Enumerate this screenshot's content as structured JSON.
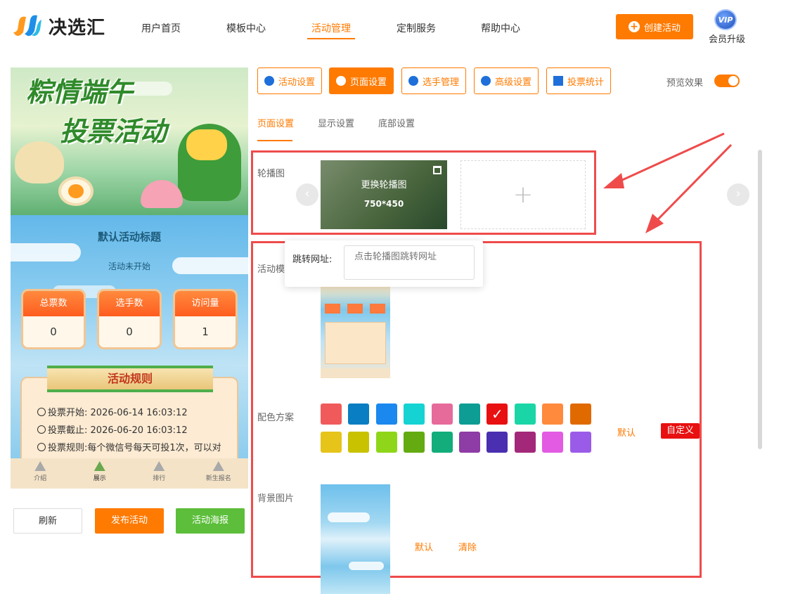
{
  "brand": {
    "name": "决选汇"
  },
  "nav": {
    "items": [
      "用户首页",
      "模板中心",
      "活动管理",
      "定制服务",
      "帮助中心"
    ],
    "active_index": 2
  },
  "header": {
    "create_label": "创建活动",
    "vip_badge": "VIP",
    "vip_label": "会员升级"
  },
  "preview": {
    "banner_line1": "粽情端午",
    "banner_line2": "投票活动",
    "title": "默认活动标题",
    "status": "活动未开始",
    "stats": [
      {
        "label": "总票数",
        "value": "0"
      },
      {
        "label": "选手数",
        "value": "0"
      },
      {
        "label": "访问量",
        "value": "1"
      }
    ],
    "rules_title": "活动规则",
    "rules": [
      {
        "label": "投票开始:",
        "value": "2026-06-14 16:03:12"
      },
      {
        "label": "投票截止:",
        "value": "2026-06-20 16:03:12"
      },
      {
        "label": "投票规则:",
        "value": "每个微信号每天可投1次，可以对"
      }
    ],
    "tabbar": [
      "介绍",
      "展示",
      "排行",
      "新生报名"
    ],
    "tabbar_active": 1
  },
  "actions": {
    "refresh": "刷新",
    "publish": "发布活动",
    "poster": "活动海报"
  },
  "top_tabs": [
    "活动设置",
    "页面设置",
    "选手管理",
    "高级设置",
    "投票统计"
  ],
  "top_tabs_active": 1,
  "preview_toggle": {
    "label": "预览效果",
    "on": true
  },
  "sub_tabs": [
    "页面设置",
    "显示设置",
    "底部设置"
  ],
  "carousel": {
    "label": "轮播图",
    "change_label": "更换轮播图",
    "size": "750*450",
    "add_icon": "+"
  },
  "jump": {
    "label": "跳转网址:",
    "placeholder": "点击轮播图跳转网址"
  },
  "template_label": "活动模",
  "color_scheme": {
    "label": "配色方案",
    "colors": [
      "#f15a5a",
      "#0a7ec2",
      "#1a88ee",
      "#15d3d3",
      "#e76b9a",
      "#0e9d94",
      "#e81010",
      "#1ad6a6",
      "#ff8a3d",
      "#e06a00",
      "#e6c41a",
      "#c8c200",
      "#8fd61a",
      "#63ab11",
      "#12ad7a",
      "#8e3ca6",
      "#4a2fb0",
      "#a3287a",
      "#e35be3",
      "#9a5ce8"
    ],
    "selected_index": 6,
    "default_label": "默认",
    "custom_label": "自定义"
  },
  "background": {
    "label": "背景图片",
    "default_label": "默认",
    "clear_label": "清除"
  },
  "colors": {
    "accent": "#ff7a00",
    "highlight_box": "#ef4b4b"
  }
}
